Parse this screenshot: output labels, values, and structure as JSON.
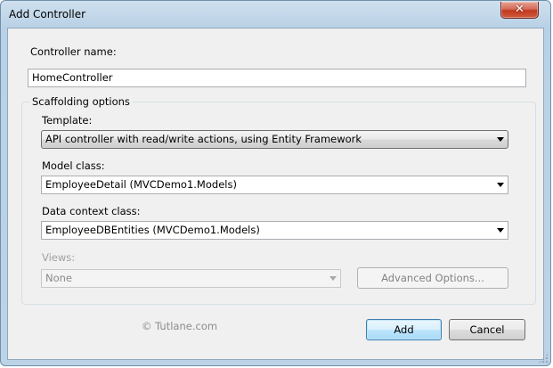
{
  "window": {
    "title": "Add Controller",
    "close_glyph": "✕"
  },
  "controller_name": {
    "label": "Controller name:",
    "value": "HomeController"
  },
  "scaffolding": {
    "legend": "Scaffolding options",
    "template": {
      "label": "Template:",
      "value": "API controller with read/write actions, using Entity Framework"
    },
    "model_class": {
      "label": "Model class:",
      "value": "EmployeeDetail (MVCDemo1.Models)"
    },
    "data_context": {
      "label": "Data context class:",
      "value": "EmployeeDBEntities (MVCDemo1.Models)"
    },
    "views": {
      "label": "Views:",
      "value": "None"
    },
    "advanced_label": "Advanced Options..."
  },
  "watermark": "© Tutlane.com",
  "buttons": {
    "add": "Add",
    "cancel": "Cancel"
  }
}
